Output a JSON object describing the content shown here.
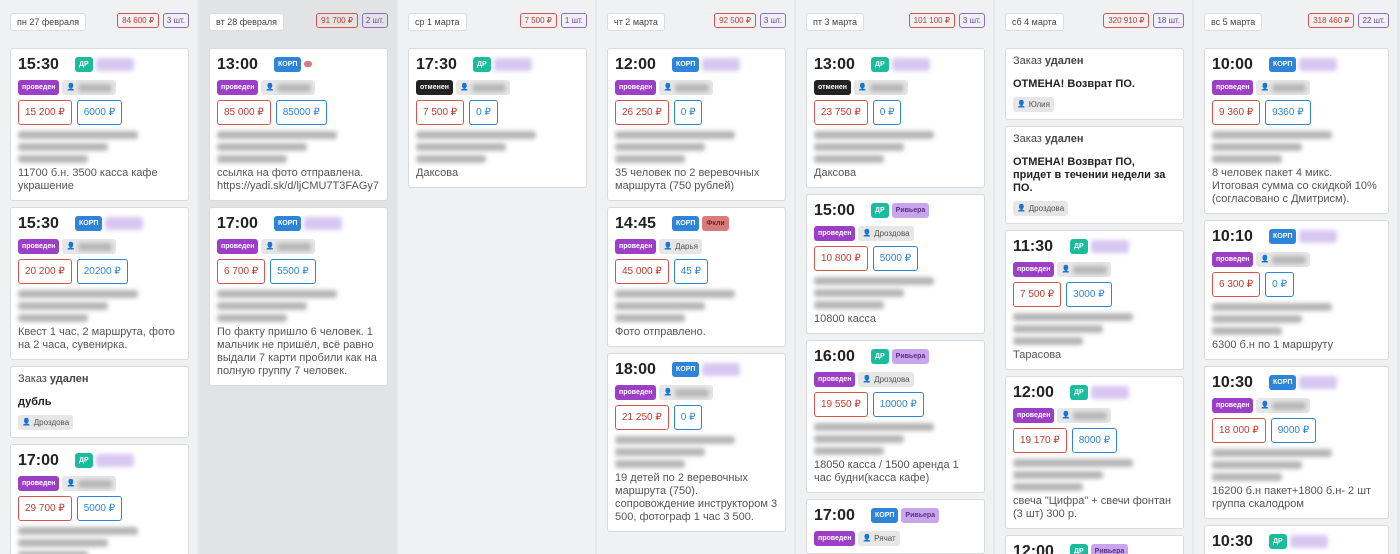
{
  "colors": {
    "red": "#c0392b",
    "blue": "#2d84d8",
    "purple": "#9b3fc7",
    "teal": "#1abc9c"
  },
  "columns": [
    {
      "day": "пн 27 февраля",
      "sum": "84 600 ₽",
      "count": "3 шт.",
      "shaded": false,
      "cards": [
        {
          "type": "order",
          "time": "15:30",
          "tag": "ДР",
          "tagClass": "dr",
          "status": "проведен",
          "amount": "15 200 ₽",
          "paid": "6000 ₽",
          "note": "11700 б.н. 3500 касса кафе украшение"
        },
        {
          "type": "order",
          "time": "15:30",
          "tag": "КОРП",
          "tagClass": "corp",
          "status": "проведен",
          "amount": "20 200 ₽",
          "paid": "20200 ₽",
          "note": "Квест 1 час, 2 маршрута, фото на 2 часа, сувенирка."
        },
        {
          "type": "deleted",
          "head1": "Заказ ",
          "head2": "удален",
          "text": "дубль",
          "person": "Дроздова"
        },
        {
          "type": "order",
          "time": "17:00",
          "tag": "ДР",
          "tagClass": "dr",
          "status": "проведен",
          "amount": "29 700 ₽",
          "paid": "5000 ₽",
          "note": ""
        }
      ]
    },
    {
      "day": "вт 28 февраля",
      "sum": "91 700 ₽",
      "count": "2 шт.",
      "shaded": true,
      "cards": [
        {
          "type": "order",
          "time": "13:00",
          "tag": "КОРП",
          "tagClass": "corp",
          "tag2": "",
          "tag2Class": "fkl",
          "status": "проведен",
          "amount": "85 000 ₽",
          "paid": "85000 ₽",
          "note": "ссылка на фото отправлена. https://yadi.sk/d/ljCMU7T3FAGy7"
        },
        {
          "type": "order",
          "time": "17:00",
          "tag": "КОРП",
          "tagClass": "corp",
          "status": "проведен",
          "amount": "6 700 ₽",
          "paid": "5500 ₽",
          "note": "По факту пришло 6 человек. 1 мальчик не пришёл, всё равно выдали 7 карти пробили как на полную группу 7 человек."
        }
      ]
    },
    {
      "day": "ср 1 марта",
      "sum": "7 500 ₽",
      "count": "1 шт.",
      "shaded": false,
      "cards": [
        {
          "type": "order",
          "time": "17:30",
          "tag": "ДР",
          "tagClass": "dr",
          "status": "отменен",
          "statusClass": "cancel",
          "amount": "7 500 ₽",
          "paid": "0 ₽",
          "note": "Даксова"
        }
      ]
    },
    {
      "day": "чт 2 марта",
      "sum": "92 500 ₽",
      "count": "3 шт.",
      "shaded": false,
      "cards": [
        {
          "type": "order",
          "time": "12:00",
          "tag": "КОРП",
          "tagClass": "corp",
          "status": "проведен",
          "amount": "26 250 ₽",
          "paid": "0 ₽",
          "note": "35 человек по 2 веревочных маршрута (750 рублей)"
        },
        {
          "type": "order",
          "time": "14:45",
          "tag": "КОРП",
          "tagClass": "corp",
          "tag2": "Фкли",
          "tag2Class": "fkl",
          "status": "проведен",
          "person": "Дарья",
          "amount": "45 000 ₽",
          "paid": "45 ₽",
          "note": "Фото отправлено."
        },
        {
          "type": "order",
          "time": "18:00",
          "tag": "КОРП",
          "tagClass": "corp",
          "status": "проведен",
          "amount": "21 250 ₽",
          "paid": "0 ₽",
          "note": "19 детей по 2 веревочных маршрута (750). сопровождение инструктором 3 500, фотограф 1 час 3 500."
        }
      ]
    },
    {
      "day": "пт 3 марта",
      "sum": "101 100 ₽",
      "count": "3 шт.",
      "shaded": false,
      "cards": [
        {
          "type": "order",
          "time": "13:00",
          "tag": "ДР",
          "tagClass": "dr",
          "status": "отменен",
          "statusClass": "cancel",
          "amount": "23 750 ₽",
          "paid": "0 ₽",
          "note": "Даксова"
        },
        {
          "type": "order",
          "time": "15:00",
          "tag": "ДР",
          "tagClass": "dr",
          "tag2": "Ривьера",
          "tag2Class": "riv",
          "status": "проведен",
          "person": "Дроздова",
          "amount": "10 800 ₽",
          "paid": "5000 ₽",
          "note": "10800 касса"
        },
        {
          "type": "order",
          "time": "16:00",
          "tag": "ДР",
          "tagClass": "dr",
          "tag2": "Ривьера",
          "tag2Class": "riv",
          "status": "проведен",
          "person": "Дроздова",
          "amount": "19 550 ₽",
          "paid": "10000 ₽",
          "note": "18050 касса / 1500 аренда 1 час будни(касса кафе)",
          "nameTail": "вич."
        },
        {
          "type": "order",
          "time": "17:00",
          "tag": "КОРП",
          "tagClass": "corp",
          "tag2": "Ривьера",
          "tag2Class": "riv",
          "status": "проведен",
          "person": "Рячат",
          "amount": "",
          "paid": "",
          "note": ""
        }
      ]
    },
    {
      "day": "сб 4 марта",
      "sum": "320 910 ₽",
      "count": "18 шт.",
      "shaded": false,
      "cards": [
        {
          "type": "deleted",
          "head1": "Заказ ",
          "head2": "удален",
          "text": "ОТМЕНА! Возврат ПО.",
          "person": "Юлия"
        },
        {
          "type": "deleted",
          "head1": "Заказ ",
          "head2": "удален",
          "text": "ОТМЕНА! Возврат ПО, придет в течении недели за ПО.",
          "person": "Дроздова"
        },
        {
          "type": "order",
          "time": "11:30",
          "tag": "ДР",
          "tagClass": "dr",
          "status": "проведен",
          "amount": "7 500 ₽",
          "paid": "3000 ₽",
          "note": "Тарасова"
        },
        {
          "type": "order",
          "time": "12:00",
          "tag": "ДР",
          "tagClass": "dr",
          "status": "проведен",
          "amount": "19 170 ₽",
          "paid": "8000 ₽",
          "note": "свеча \"Цифра\" + свечи фонтан (3 шт) 300 р."
        },
        {
          "type": "order",
          "time": "12:00",
          "tag": "ДР",
          "tagClass": "dr",
          "tag2": "Ривьера",
          "tag2Class": "riv",
          "status": "",
          "amount": "",
          "paid": "",
          "note": ""
        }
      ]
    },
    {
      "day": "вс 5 марта",
      "sum": "318 460 ₽",
      "count": "22 шт.",
      "shaded": false,
      "cards": [
        {
          "type": "order",
          "time": "10:00",
          "tag": "КОРП",
          "tagClass": "corp",
          "status": "проведен",
          "amount": "9 360 ₽",
          "paid": "9360 ₽",
          "note": "8 человек пакет 4 микс. Итоговая сумма со скидкой 10% (согласовано с Дмитрисм)."
        },
        {
          "type": "order",
          "time": "10:10",
          "tag": "КОРП",
          "tagClass": "corp",
          "status": "проведен",
          "amount": "6 300 ₽",
          "paid": "0 ₽",
          "note": "6300 б.н по 1 маршруту"
        },
        {
          "type": "order",
          "time": "10:30",
          "tag": "КОРП",
          "tagClass": "corp",
          "status": "проведен",
          "amount": "18 000 ₽",
          "paid": "9000 ₽",
          "note": "16200 б.н пакет+1800 б.н- 2 шт группа скалодром"
        },
        {
          "type": "order",
          "time": "10:30",
          "tag": "ДР",
          "tagClass": "dr",
          "status": "проведен",
          "amount": "",
          "paid": "",
          "note": ""
        }
      ]
    }
  ]
}
